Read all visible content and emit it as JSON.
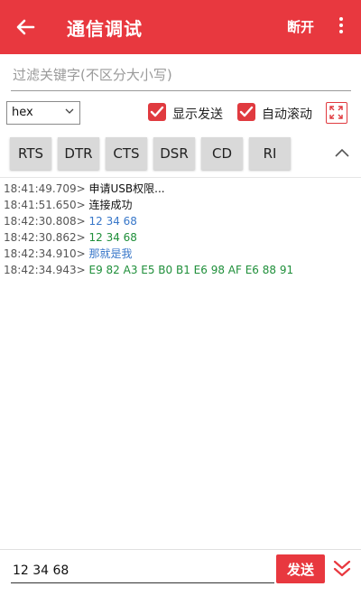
{
  "header": {
    "title": "通信调试",
    "disconnect_label": "断开"
  },
  "filter": {
    "placeholder": "过滤关键字(不区分大小写)",
    "value": ""
  },
  "options": {
    "format_selected": "hex",
    "show_send": {
      "label": "显示发送",
      "checked": true
    },
    "auto_scroll": {
      "label": "自动滚动",
      "checked": true
    }
  },
  "signals": [
    {
      "label": "RTS"
    },
    {
      "label": "DTR"
    },
    {
      "label": "CTS"
    },
    {
      "label": "DSR"
    },
    {
      "label": "CD"
    },
    {
      "label": "RI"
    }
  ],
  "log": [
    {
      "time": "18:41:49.709>",
      "text": "申请USB权限...",
      "color": "#111111"
    },
    {
      "time": "18:41:51.650>",
      "text": "连接成功",
      "color": "#111111"
    },
    {
      "time": "18:42:30.808>",
      "text": "12 34 68",
      "color": "#3877c9"
    },
    {
      "time": "18:42:30.862>",
      "text": "12 34 68",
      "color": "#1f8f3a"
    },
    {
      "time": "18:42:34.910>",
      "text": "那就是我",
      "color": "#3877c9"
    },
    {
      "time": "18:42:34.943>",
      "text": "E9 82 A3 E5 B0 B1 E6 98 AF E6 88 91",
      "color": "#1f8f3a"
    }
  ],
  "send": {
    "value": "12 34 68",
    "button_label": "发送"
  },
  "colors": {
    "accent": "#e8383f",
    "sent": "#3877c9",
    "received": "#1f8f3a"
  },
  "icons": [
    "back-arrow-icon",
    "more-vert-icon",
    "chevron-down-icon",
    "checkmark-icon",
    "expand-icon",
    "chevron-up-icon",
    "double-chevron-down-icon"
  ]
}
